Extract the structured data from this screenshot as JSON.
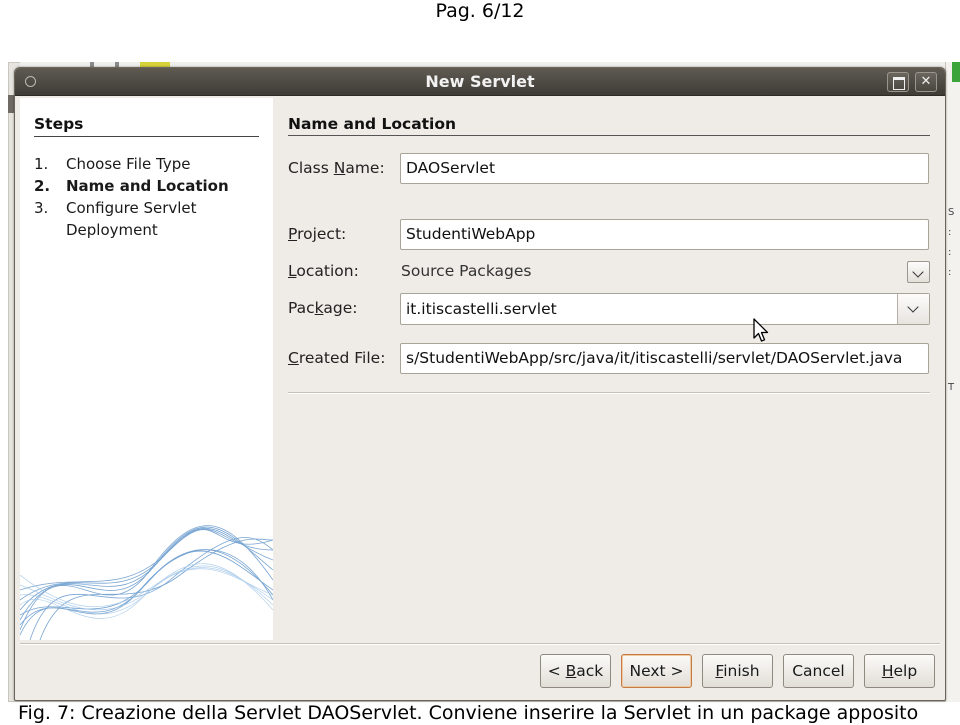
{
  "page": {
    "header": "Pag. 6/12",
    "caption": "Fig. 7: Creazione della Servlet DAOServlet. Conviene inserire la Servlet in un package apposito"
  },
  "dialog": {
    "title": "New Servlet",
    "titlebar_buttons": [
      "maximize-icon",
      "close-icon"
    ],
    "steps": {
      "title": "Steps",
      "items": [
        {
          "number": "1.",
          "label": "Choose File Type",
          "active": false
        },
        {
          "number": "2.",
          "label": "Name and Location",
          "active": true
        },
        {
          "number": "3.",
          "label": "Configure Servlet",
          "active": false
        },
        {
          "number": "",
          "label": "Deployment",
          "active": false
        }
      ]
    },
    "panel": {
      "title": "Name and Location",
      "class_name": {
        "label_pre": "Class ",
        "label_mnemonic": "N",
        "label_post": "ame:",
        "value": "DAOServlet"
      },
      "project": {
        "label_mnemonic": "P",
        "label_post": "roject:",
        "value": "StudentiWebApp"
      },
      "location": {
        "label_mnemonic": "L",
        "label_post": "ocation:",
        "value": "Source Packages"
      },
      "package": {
        "label_pre": "Pac",
        "label_mnemonic": "k",
        "label_post": "age:",
        "value": "it.itiscastelli.servlet"
      },
      "created_file": {
        "label_mnemonic": "C",
        "label_post": "reated File:",
        "value": "s/StudentiWebApp/src/java/it/itiscastelli/servlet/DAOServlet.java"
      }
    },
    "buttons": {
      "back": {
        "pre": "< ",
        "mnemonic": "B",
        "post": "ack"
      },
      "next": {
        "label": "Next >"
      },
      "finish": {
        "mnemonic": "F",
        "post": "inish"
      },
      "cancel": {
        "label": "Cancel"
      },
      "help": {
        "mnemonic": "H",
        "post": "elp"
      }
    }
  },
  "colors": {
    "titlebar": "#4f4b44",
    "dialog_bg": "#efebe6",
    "default_button_border": "#c47c44"
  }
}
